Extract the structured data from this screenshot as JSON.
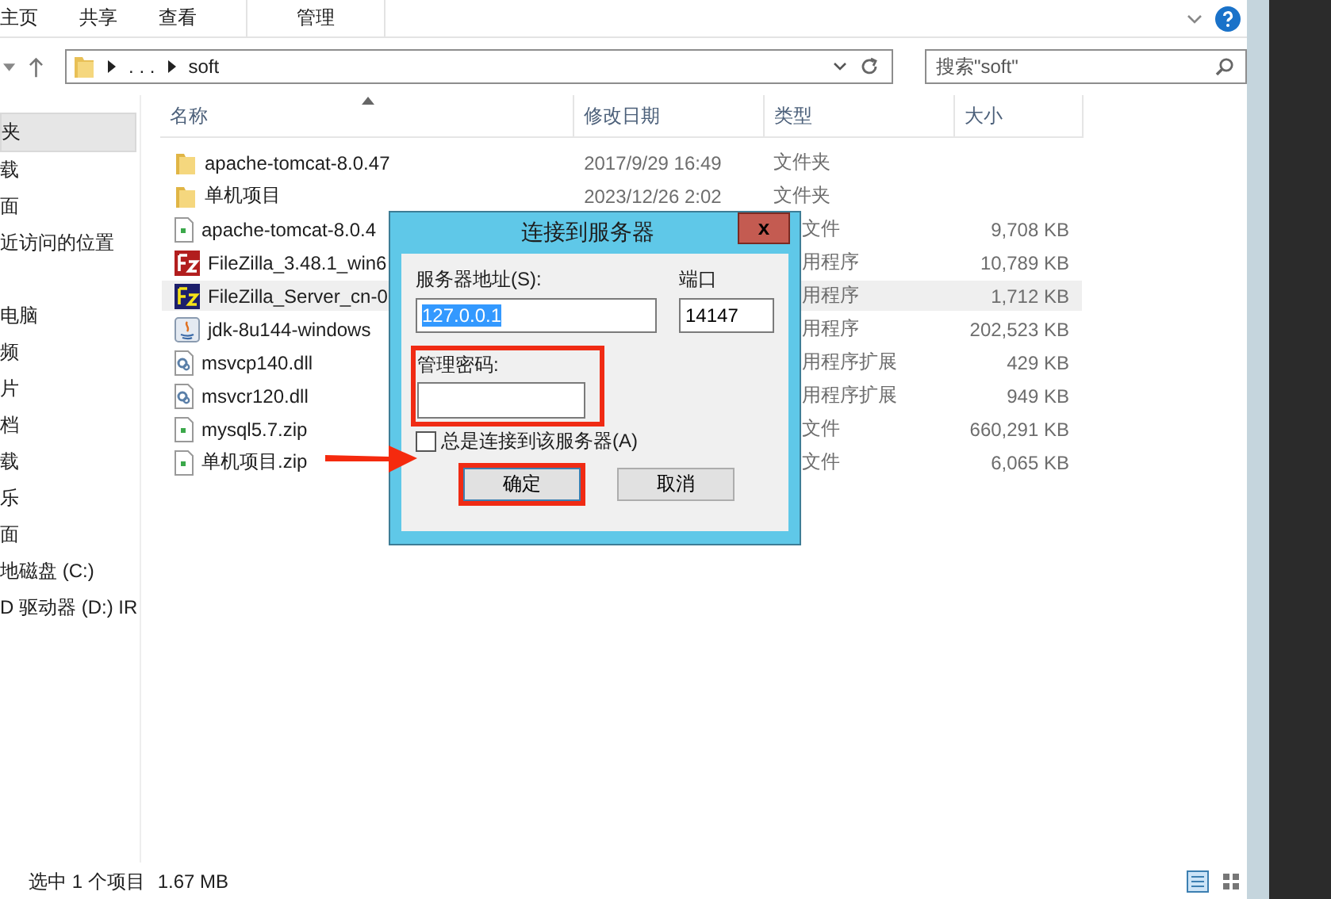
{
  "ribbon": {
    "tabs": [
      {
        "label": "主页"
      },
      {
        "label": "共享"
      },
      {
        "label": "查看"
      },
      {
        "label": "管理"
      }
    ]
  },
  "address": {
    "ellipsis": ". . .",
    "folder": "soft"
  },
  "search": {
    "placeholder": "搜索\"soft\""
  },
  "sidebar": {
    "items": [
      {
        "label": "夹",
        "selected": true
      },
      {
        "label": "载",
        "selected": false
      },
      {
        "label": "面",
        "selected": false
      },
      {
        "label": "近访问的位置",
        "selected": false
      },
      {
        "label": "电脑",
        "selected": false
      },
      {
        "label": "频",
        "selected": false
      },
      {
        "label": "片",
        "selected": false
      },
      {
        "label": "档",
        "selected": false
      },
      {
        "label": "载",
        "selected": false
      },
      {
        "label": "乐",
        "selected": false
      },
      {
        "label": "面",
        "selected": false
      },
      {
        "label": "地磁盘 (C:)",
        "selected": false
      },
      {
        "label": "D 驱动器 (D:) IR",
        "selected": false
      }
    ]
  },
  "table": {
    "columns": [
      "名称",
      "修改日期",
      "类型",
      "大小"
    ],
    "rows": [
      {
        "kind": "folder",
        "name": "apache-tomcat-8.0.47",
        "date": "2017/9/29 16:49",
        "type": "文件夹",
        "selected": false
      },
      {
        "kind": "folder",
        "name": "单机项目",
        "date": "2023/12/26 2:02",
        "type": "文件夹",
        "selected": false
      },
      {
        "kind": "archive",
        "name": "apache-tomcat-8.0.4",
        "type": "文件",
        "size": "9,708 KB",
        "selected": false
      },
      {
        "kind": "filezilla",
        "name": "FileZilla_3.48.1_win6",
        "type": "用程序",
        "size": "10,789 KB",
        "selected": false
      },
      {
        "kind": "filezilla-server",
        "name": "FileZilla_Server_cn-0",
        "type": "用程序",
        "size": "1,712 KB",
        "selected": true
      },
      {
        "kind": "java",
        "name": "jdk-8u144-windows",
        "type": "用程序",
        "size": "202,523 KB",
        "selected": false
      },
      {
        "kind": "dll",
        "name": "msvcp140.dll",
        "type": "用程序扩展",
        "size": "429 KB",
        "selected": false
      },
      {
        "kind": "dll",
        "name": "msvcr120.dll",
        "type": "用程序扩展",
        "size": "949 KB",
        "selected": false
      },
      {
        "kind": "archive",
        "name": "mysql5.7.zip",
        "type": "文件",
        "size": "660,291 KB",
        "selected": false
      },
      {
        "kind": "archive",
        "name": "单机项目.zip",
        "type": "文件",
        "size": "6,065 KB",
        "selected": false
      }
    ]
  },
  "status_bar": {
    "selection": "选中 1 个项目",
    "size": "1.67 MB"
  },
  "dialog": {
    "title": "连接到服务器",
    "close": "x",
    "address_label": "服务器地址(S):",
    "address_value": "127.0.0.1",
    "port_label": "端口",
    "port_value": "14147",
    "password_label": "管理密码:",
    "always_connect": {
      "label": "总是连接到该服务器(A)",
      "checked": false
    },
    "buttons": [
      "确定",
      "取消"
    ]
  }
}
